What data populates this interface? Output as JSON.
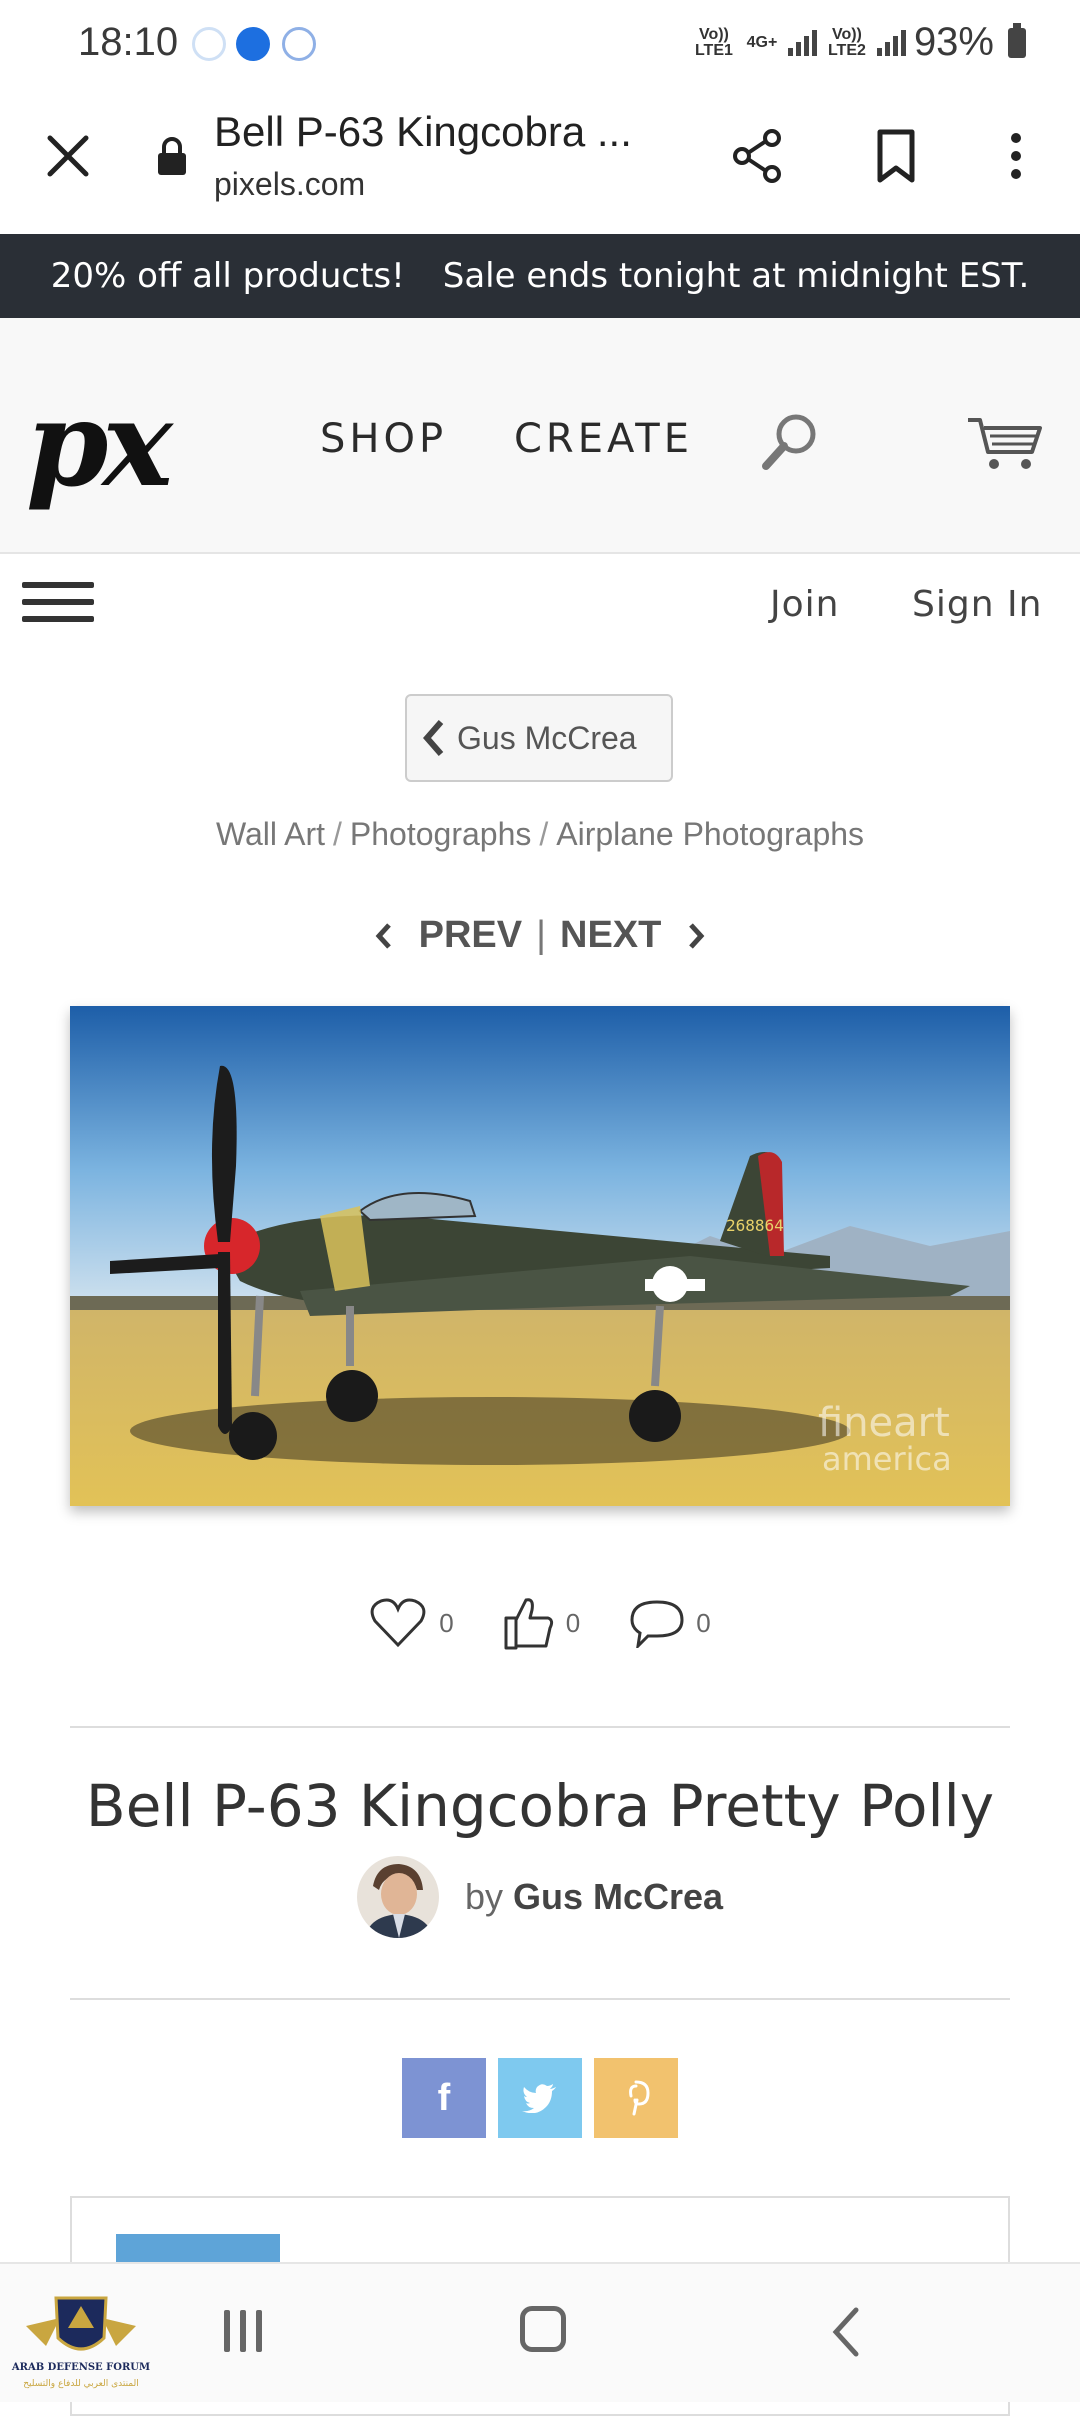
{
  "status_bar": {
    "time": "18:10",
    "sim1": "Vo)) LTE1",
    "sim2_top": "4G+",
    "sim3": "Vo)) LTE2",
    "battery": "93%"
  },
  "browser": {
    "title": "Bell P-63 Kingcobra ...",
    "domain": "pixels.com"
  },
  "promo": {
    "left": "20% off all products!",
    "right": "Sale ends tonight at midnight EST."
  },
  "header": {
    "logo": "px",
    "shop": "SHOP",
    "create": "CREATE"
  },
  "account": {
    "join": "Join",
    "sign_in": "Sign In"
  },
  "artist_back": "Gus McCrea",
  "breadcrumb": [
    "Wall Art",
    "Photographs",
    "Airplane Photographs"
  ],
  "pager": {
    "prev": "PREV",
    "sep": "|",
    "next": "NEXT"
  },
  "artwork": {
    "tail_number": "268864",
    "watermark_top": "fineart",
    "watermark_bottom": "america"
  },
  "reactions": {
    "favorites": "0",
    "likes": "0",
    "comments": "0"
  },
  "title": "Bell P-63 Kingcobra Pretty Polly",
  "byline": {
    "by": "by",
    "artist": "Gus McCrea"
  },
  "share": {
    "facebook": "f"
  },
  "colors": {
    "promo_bg": "#2a2f36",
    "facebook": "#7d93d3",
    "twitter": "#7ec9ef",
    "pinterest": "#f2c26e"
  },
  "forum_logo": {
    "name": "ARAB DEFENSE FORUM",
    "arabic": "المنتدى العربي للدفاع والتسليح"
  }
}
